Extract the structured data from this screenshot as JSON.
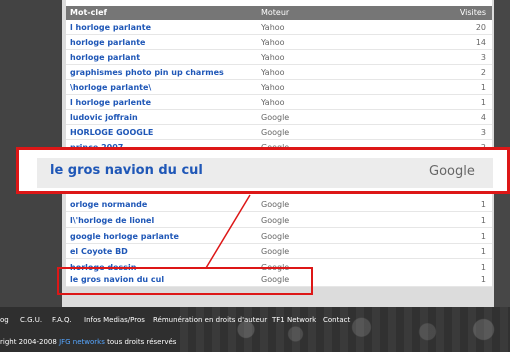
{
  "table": {
    "headers": {
      "keyword": "Mot-clef",
      "engine": "Moteur",
      "visits": "Visites"
    },
    "rows_top": [
      {
        "keyword": "l horloge parlante",
        "engine": "Yahoo",
        "visits": "20"
      },
      {
        "keyword": "horloge parlante",
        "engine": "Yahoo",
        "visits": "14"
      },
      {
        "keyword": "horloge parlant",
        "engine": "Yahoo",
        "visits": "3"
      },
      {
        "keyword": "graphismes photo pin up charmes",
        "engine": "Yahoo",
        "visits": "2"
      },
      {
        "keyword": "\\horloge parlante\\",
        "engine": "Yahoo",
        "visits": "1"
      },
      {
        "keyword": "l horloge parlente",
        "engine": "Yahoo",
        "visits": "1"
      },
      {
        "keyword": "ludovic joffrain",
        "engine": "Google",
        "visits": "4"
      },
      {
        "keyword": "HORLOGE GOOGLE",
        "engine": "Google",
        "visits": "3"
      },
      {
        "keyword": "prince 2007",
        "engine": "Google",
        "visits": "2"
      }
    ],
    "rows_bottom": [
      {
        "keyword": "orloge normande",
        "engine": "Google",
        "visits": "1"
      },
      {
        "keyword": "l\\'horloge de lionel",
        "engine": "Google",
        "visits": "1"
      },
      {
        "keyword": "google horloge parlante",
        "engine": "Google",
        "visits": "1"
      },
      {
        "keyword": "el Coyote BD",
        "engine": "Google",
        "visits": "1"
      },
      {
        "keyword": "horloge dessin",
        "engine": "Google",
        "visits": "1"
      },
      {
        "keyword": "le gros navion du cul",
        "engine": "Google",
        "visits": "1"
      }
    ]
  },
  "zoom": {
    "keyword": "le gros navion du cul",
    "engine": "Google"
  },
  "footer": {
    "links": [
      "og",
      "C.G.U.",
      "F.A.Q.",
      "Infos Medias/Pros",
      "Rémunération en droits d'auteur",
      "TF1 Network",
      "Contact"
    ],
    "copyright_prefix": "right 2004-2008 ",
    "brand": "JFG networks",
    "copyright_suffix": " tous droits réservés"
  },
  "colors": {
    "link_blue": "#1f57b7",
    "highlight_red": "#dd1717"
  }
}
